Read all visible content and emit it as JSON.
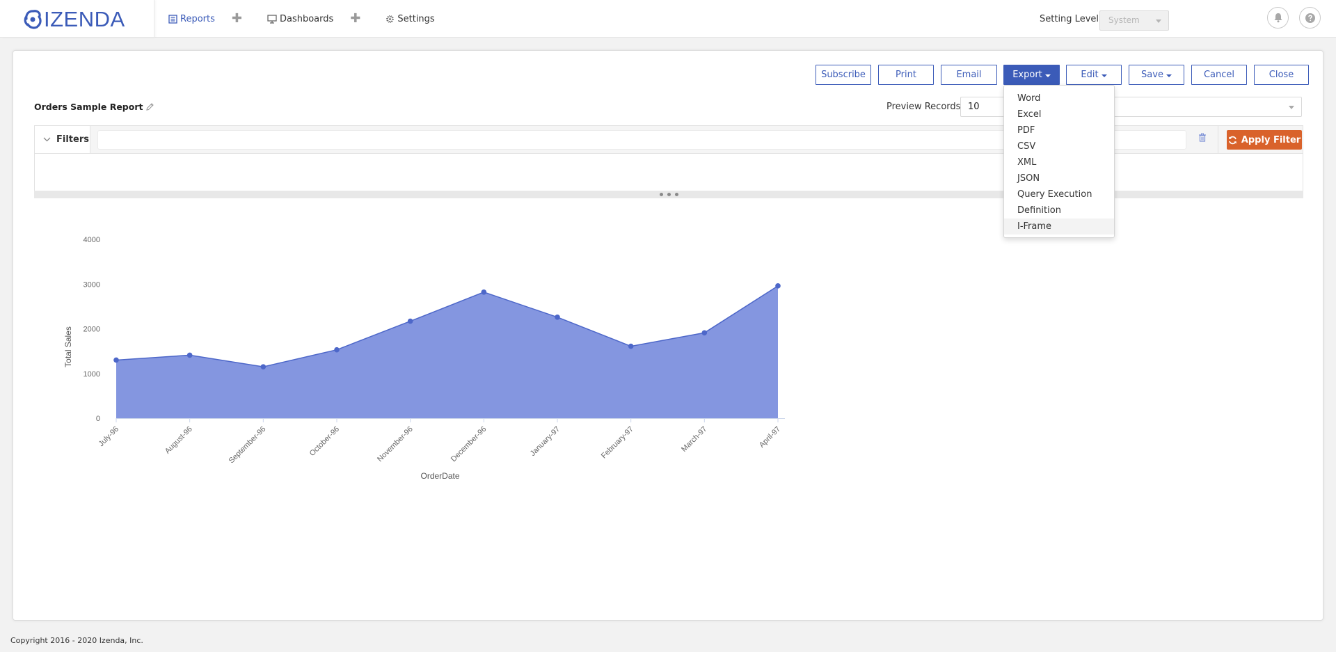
{
  "brand": {
    "logo_text": "IZENDA"
  },
  "nav": {
    "reports_label": "Reports",
    "dashboards_label": "Dashboards",
    "settings_label": "Settings",
    "add_symbol": "✚"
  },
  "header": {
    "setting_level_label": "Setting Level",
    "setting_level_value": "System"
  },
  "toolbar": {
    "subscribe": "Subscribe",
    "print": "Print",
    "email": "Email",
    "export": "Export",
    "edit": "Edit",
    "save": "Save",
    "cancel": "Cancel",
    "close": "Close"
  },
  "report": {
    "title": "Orders Sample Report",
    "preview_label": "Preview Records",
    "preview_value": "10"
  },
  "filters": {
    "label": "Filters",
    "apply_label": "Apply Filter"
  },
  "export_menu": {
    "items": [
      "Word",
      "Excel",
      "PDF",
      "CSV",
      "XML",
      "JSON",
      "Query Execution",
      "Definition",
      "I-Frame"
    ],
    "hovered": "I-Frame"
  },
  "colors": {
    "accent": "#3b5bb8",
    "area_fill": "#8496e0",
    "area_line": "#4d67c9",
    "apply_button": "#d9622b"
  },
  "icons": {
    "reports": "report-list-icon",
    "dashboards": "monitor-icon",
    "settings": "gear-icon",
    "notifications": "bell-icon",
    "help": "question-icon",
    "edit_title": "pencil-icon",
    "filters_toggle": "chevron-down-icon",
    "clear_filters": "trash-icon",
    "apply": "refresh-icon"
  },
  "chart_data": {
    "type": "area",
    "xlabel": "OrderDate",
    "ylabel": "Total Sales",
    "x": [
      "July-96",
      "August-96",
      "September-96",
      "October-96",
      "November-96",
      "December-96",
      "January-97",
      "February-97",
      "March-97",
      "April-97"
    ],
    "series": [
      {
        "values": [
          1300,
          1410,
          1150,
          1530,
          2170,
          2820,
          2260,
          1610,
          1910,
          2960
        ]
      }
    ],
    "yticks": [
      0,
      1000,
      2000,
      3000,
      4000
    ],
    "ylim": [
      0,
      4000
    ],
    "grid": false,
    "legend": "none"
  },
  "footer": {
    "copyright": "Copyright 2016 - 2020 Izenda, Inc."
  }
}
